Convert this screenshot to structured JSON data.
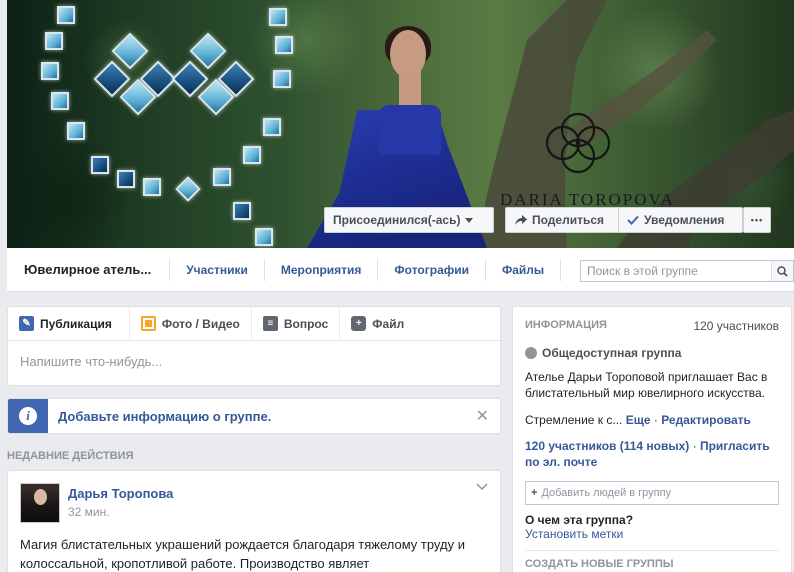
{
  "cover": {
    "logo_text": "DARIA TOROPOVA",
    "join_button": "Присоединился(-ась)",
    "share_button": "Поделиться",
    "notify_button": "Уведомления",
    "more_button": "•••"
  },
  "nav": {
    "group_name": "Ювелирное атель...",
    "items": [
      "Участники",
      "Мероприятия",
      "Фотографии",
      "Файлы"
    ],
    "search_placeholder": "Поиск в этой группе"
  },
  "composer": {
    "tabs": [
      {
        "label": "Публикация",
        "icon": "pencil-icon"
      },
      {
        "label": "Фото / Видео",
        "icon": "photo-icon"
      },
      {
        "label": "Вопрос",
        "icon": "poll-icon"
      },
      {
        "label": "Файл",
        "icon": "plus-icon"
      }
    ],
    "prompt": "Напишите что-нибудь..."
  },
  "banner": {
    "text": "Добавьте информацию о группе.",
    "close": "✕"
  },
  "recent_activity": {
    "title": "НЕДАВНИЕ ДЕЙСТВИЯ"
  },
  "post": {
    "author": "Дарья Торопова",
    "time": "32 мин.",
    "text": "Магия блистательных украшений рождается благодаря тяжелому труду и колоссальной, кропотливой работе. Производство являет"
  },
  "info": {
    "header": "ИНФОРМАЦИЯ",
    "member_count": "120 участников",
    "privacy": "Общедоступная группа",
    "description": "Ателье Дарьи Тороповой приглашает Вас в блистательный мир ювелирного искусства.",
    "aspiration": "Стремление к с...",
    "more_link": "Еще",
    "dot": " · ",
    "edit_link": "Редактировать",
    "members_link": "120 участников (114 новых)",
    "invite_link": "Пригласить по эл. почте",
    "add_people_placeholder": "Добавить людей в группу",
    "question": "О чем эта группа?",
    "set_tags": "Установить метки",
    "create_groups": "СОЗДАТЬ НОВЫЕ ГРУППЫ"
  },
  "colors": {
    "accent": "#4267b2",
    "link": "#365899",
    "background": "#e9ebee"
  }
}
